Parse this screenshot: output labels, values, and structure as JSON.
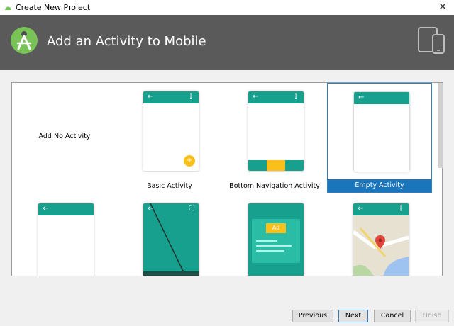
{
  "window": {
    "title": "Create New Project",
    "close_glyph": "✕"
  },
  "header": {
    "title": "Add an Activity to Mobile",
    "logo_icon": "android-studio-icon",
    "devices_icon": "phone-tablet-icon"
  },
  "gallery": {
    "tiles": [
      {
        "label": "Add No Activity",
        "selected": false
      },
      {
        "label": "Basic Activity",
        "selected": false
      },
      {
        "label": "Bottom Navigation Activity",
        "selected": false
      },
      {
        "label": "Empty Activity",
        "selected": true
      },
      {
        "label": "",
        "selected": false
      },
      {
        "label": "",
        "selected": false
      },
      {
        "label": "",
        "selected": false
      },
      {
        "label": "",
        "selected": false
      }
    ],
    "ad_badge": "Ad"
  },
  "footer": {
    "previous": "Previous",
    "next": "Next",
    "cancel": "Cancel",
    "finish": "Finish"
  },
  "colors": {
    "accent": "#16a08d",
    "selection": "#1b75bb",
    "fab": "#fbbf1a",
    "header_bg": "#5a5a5a"
  }
}
